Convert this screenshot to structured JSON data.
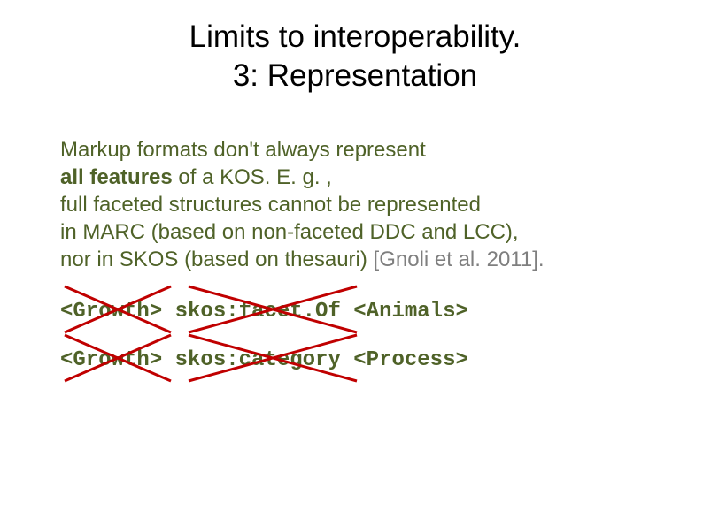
{
  "title": {
    "line1": "Limits to interoperability.",
    "line2": "3: Representation"
  },
  "body": {
    "line1a": "Markup formats don't always represent",
    "line2a_bold": "all features",
    "line2b": " of a KOS.   E. g. ,",
    "line3": "full faceted structures cannot be  represented",
    "line4": "in MARC (based on non-faceted DDC and LCC),",
    "line5a": "nor in SKOS (based on thesauri) ",
    "line5_cite": "[Gnoli et al. 2011]",
    "line5_dot": "."
  },
  "code1": {
    "t1": "<Growth>",
    "t2": "skos:facet.Of",
    "t3": "<Animals>"
  },
  "code2": {
    "t1": "<Growth>",
    "t2": "skos:category",
    "t3": "<Process>"
  }
}
